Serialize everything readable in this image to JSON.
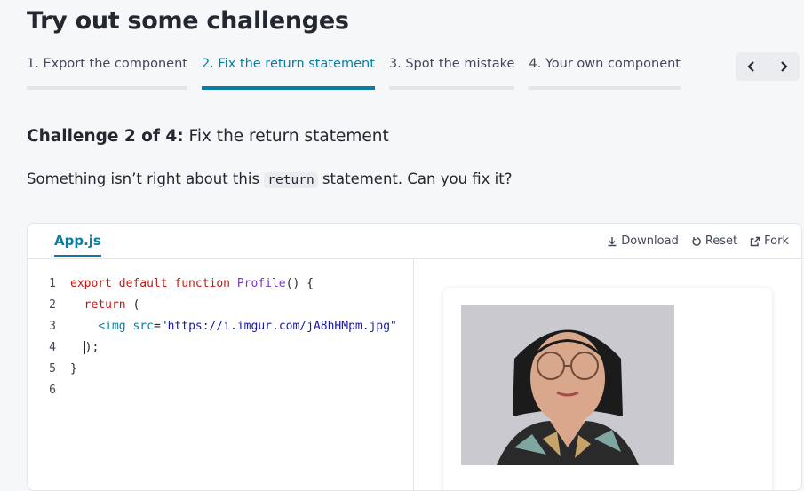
{
  "page": {
    "title": "Try out some challenges"
  },
  "tabs": [
    {
      "label": "1. Export the component"
    },
    {
      "label": "2. Fix the return statement",
      "active": true
    },
    {
      "label": "3. Spot the mistake"
    },
    {
      "label": "4. Your own component"
    }
  ],
  "nav": {
    "prev_icon": "chevron-left-icon",
    "next_icon": "chevron-right-icon"
  },
  "challenge": {
    "prefix": "Challenge 2 of 4:",
    "title": "Fix the return statement",
    "desc_before": "Something isn’t right about this ",
    "desc_code": "return",
    "desc_after": " statement. Can you fix it?"
  },
  "sandbox": {
    "file_tab": "App.js",
    "actions": {
      "download": "Download",
      "reset": "Reset",
      "fork": "Fork"
    },
    "code": {
      "line_numbers": [
        "1",
        "2",
        "3",
        "4",
        "5",
        "6"
      ],
      "l1": {
        "kw": "export default function ",
        "fn": "Profile",
        "rest": "() {"
      },
      "l2": {
        "kw": "return",
        "rest": " ("
      },
      "l3": {
        "tag": "<img",
        "attr": " src",
        "eq": "=",
        "str": "\"https://i.imgur.com/jA8hHMpm.jpg\""
      },
      "l4": {
        "text": ");"
      },
      "l5": {
        "text": "}"
      }
    }
  },
  "colors": {
    "accent": "#087ea4",
    "text": "#23272f",
    "keyword": "#c41a16"
  }
}
